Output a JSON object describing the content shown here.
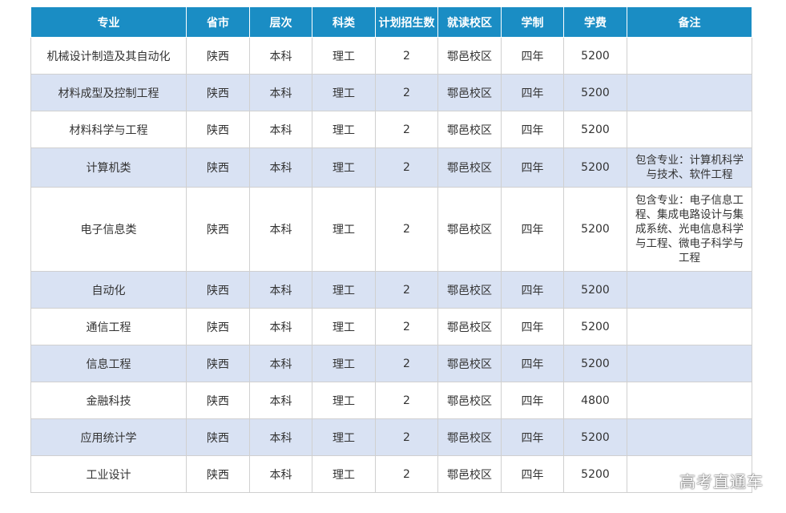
{
  "table": {
    "headers": [
      "专业",
      "省市",
      "层次",
      "科类",
      "计划招生数",
      "就读校区",
      "学制",
      "学费",
      "备注"
    ],
    "rows": [
      [
        "机械设计制造及其自动化",
        "陕西",
        "本科",
        "理工",
        "2",
        "鄠邑校区",
        "四年",
        "5200",
        ""
      ],
      [
        "材料成型及控制工程",
        "陕西",
        "本科",
        "理工",
        "2",
        "鄠邑校区",
        "四年",
        "5200",
        ""
      ],
      [
        "材料科学与工程",
        "陕西",
        "本科",
        "理工",
        "2",
        "鄠邑校区",
        "四年",
        "5200",
        ""
      ],
      [
        "计算机类",
        "陕西",
        "本科",
        "理工",
        "2",
        "鄠邑校区",
        "四年",
        "5200",
        "包含专业：计算机科学与技术、软件工程"
      ],
      [
        "电子信息类",
        "陕西",
        "本科",
        "理工",
        "2",
        "鄠邑校区",
        "四年",
        "5200",
        "包含专业：电子信息工程、集成电路设计与集成系统、光电信息科学与工程、微电子科学与工程"
      ],
      [
        "自动化",
        "陕西",
        "本科",
        "理工",
        "2",
        "鄠邑校区",
        "四年",
        "5200",
        ""
      ],
      [
        "通信工程",
        "陕西",
        "本科",
        "理工",
        "2",
        "鄠邑校区",
        "四年",
        "5200",
        ""
      ],
      [
        "信息工程",
        "陕西",
        "本科",
        "理工",
        "2",
        "鄠邑校区",
        "四年",
        "5200",
        ""
      ],
      [
        "金融科技",
        "陕西",
        "本科",
        "理工",
        "2",
        "鄠邑校区",
        "四年",
        "4800",
        ""
      ],
      [
        "应用统计学",
        "陕西",
        "本科",
        "理工",
        "2",
        "鄠邑校区",
        "四年",
        "5200",
        ""
      ],
      [
        "工业设计",
        "陕西",
        "本科",
        "理工",
        "2",
        "鄠邑校区",
        "四年",
        "5200",
        ""
      ]
    ]
  },
  "watermark": "高考直通车",
  "colors": {
    "header_bg": "#1a8dc4",
    "alt_row_bg": "#d9e2f3"
  }
}
